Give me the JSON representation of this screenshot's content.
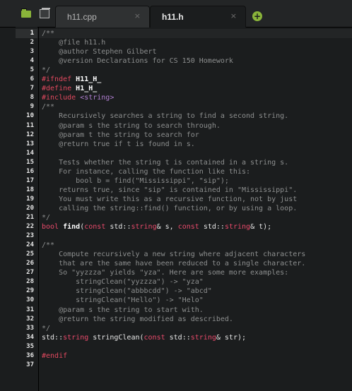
{
  "toolbar": {
    "folder_icon": "folder-icon",
    "tabs_icon": "tab-list-icon"
  },
  "tabs": [
    {
      "label": "h11.cpp",
      "close": "×",
      "active": false
    },
    {
      "label": "h11.h",
      "close": "×",
      "active": true
    }
  ],
  "add_tab": "+",
  "current_line": 1,
  "lines": [
    [
      [
        "c",
        "/**"
      ]
    ],
    [
      [
        "c",
        "    @file h11.h"
      ]
    ],
    [
      [
        "c",
        "    @author Stephen Gilbert"
      ]
    ],
    [
      [
        "c",
        "    @version Declarations for CS 150 Homework"
      ]
    ],
    [
      [
        "c",
        "*/"
      ]
    ],
    [
      [
        "pp",
        "#ifndef "
      ],
      [
        "ppn",
        "H11_H_"
      ]
    ],
    [
      [
        "pp",
        "#define "
      ],
      [
        "ppn",
        "H1_H_"
      ]
    ],
    [
      [
        "pp",
        "#include "
      ],
      [
        "str",
        "<string>"
      ]
    ],
    [
      [
        "c",
        "/**"
      ]
    ],
    [
      [
        "c",
        "    Recursively searches a string to find a second string."
      ]
    ],
    [
      [
        "c",
        "    @param s the string to search through."
      ]
    ],
    [
      [
        "c",
        "    @param t the string to search for"
      ]
    ],
    [
      [
        "c",
        "    @return true if t is found in s."
      ]
    ],
    [
      [
        "c",
        ""
      ]
    ],
    [
      [
        "c",
        "    Tests whether the string t is contained in a string s."
      ]
    ],
    [
      [
        "c",
        "    For instance, calling the function like this:"
      ]
    ],
    [
      [
        "c",
        "        bool b = find(\"Mississippi\", \"sip\");"
      ]
    ],
    [
      [
        "c",
        "    returns true, since \"sip\" is contained in \"Mississippi\"."
      ]
    ],
    [
      [
        "c",
        "    You must write this as a recursive function, not by just"
      ]
    ],
    [
      [
        "c",
        "    calling the string::find() function, or by using a loop."
      ]
    ],
    [
      [
        "c",
        "*/"
      ]
    ],
    [
      [
        "ty",
        "bool "
      ],
      [
        "id",
        "find"
      ],
      [
        "kw",
        "("
      ],
      [
        "ty",
        "const "
      ],
      [
        "ns",
        "std::"
      ],
      [
        "ty",
        "string"
      ],
      [
        "kw",
        "& s, "
      ],
      [
        "ty",
        "const "
      ],
      [
        "ns",
        "std::"
      ],
      [
        "ty",
        "string"
      ],
      [
        "kw",
        "& t);"
      ]
    ],
    [
      [
        "c",
        ""
      ]
    ],
    [
      [
        "c",
        "/**"
      ]
    ],
    [
      [
        "c",
        "    Compute recursively a new string where adjacent characters"
      ]
    ],
    [
      [
        "c",
        "    that are the same have been reduced to a single character."
      ]
    ],
    [
      [
        "c",
        "    So \"yyzzza\" yields \"yza\". Here are some more examples:"
      ]
    ],
    [
      [
        "c",
        "        stringClean(\"yyzzza\") -> \"yza\""
      ]
    ],
    [
      [
        "c",
        "        stringClean(\"abbbcdd\") -> \"abcd\""
      ]
    ],
    [
      [
        "c",
        "        stringClean(\"Hello\") -> \"Helo\""
      ]
    ],
    [
      [
        "c",
        "    @param s the string to start with."
      ]
    ],
    [
      [
        "c",
        "    @return the string modified as described."
      ]
    ],
    [
      [
        "c",
        "*/"
      ]
    ],
    [
      [
        "ns",
        "std::"
      ],
      [
        "ty",
        "string "
      ],
      [
        "kw",
        "stringClean("
      ],
      [
        "ty",
        "const "
      ],
      [
        "ns",
        "std::"
      ],
      [
        "ty",
        "string"
      ],
      [
        "kw",
        "& str);"
      ]
    ],
    [
      [
        "c",
        ""
      ]
    ],
    [
      [
        "pp",
        "#endif"
      ]
    ],
    [
      [
        "c",
        ""
      ]
    ]
  ]
}
